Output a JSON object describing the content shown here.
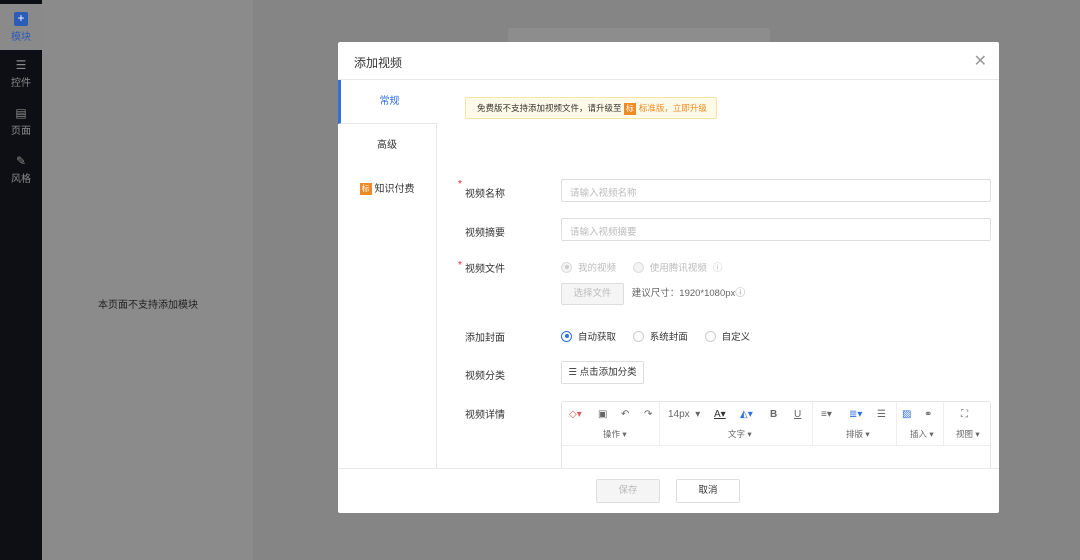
{
  "sidebar": {
    "items": [
      {
        "label": "模块",
        "icon": "plus-square-icon"
      },
      {
        "label": "控件",
        "icon": "sliders-icon"
      },
      {
        "label": "页面",
        "icon": "page-icon"
      },
      {
        "label": "风格",
        "icon": "magic-wand-icon"
      }
    ]
  },
  "panel": {
    "empty_text": "本页面不支持添加模块"
  },
  "modal": {
    "title": "添加视频",
    "tabs": [
      {
        "label": "常规"
      },
      {
        "label": "高级"
      },
      {
        "label": "知识付费",
        "badge": "标"
      }
    ],
    "notice": {
      "text": "免费版不支持添加视频文件，请升级至",
      "badge": "标",
      "edition": "标准版，",
      "link": "立即升级"
    },
    "fields": {
      "name": {
        "label": "视频名称",
        "placeholder": "请输入视频名称"
      },
      "summary": {
        "label": "视频摘要",
        "placeholder": "请输入视频摘要"
      },
      "file": {
        "label": "视频文件",
        "options": [
          "我的视频",
          "使用腾讯视频"
        ],
        "choose_button": "选择文件",
        "hint": "建议尺寸：1920*1080px"
      },
      "cover": {
        "label": "添加封面",
        "options": [
          "自动获取",
          "系统封面",
          "自定义"
        ]
      },
      "category": {
        "label": "视频分类",
        "button": "点击添加分类"
      },
      "detail": {
        "label": "视频详情",
        "font_size": "14px",
        "groups": [
          "操作",
          "文字",
          "排版",
          "插入",
          "视图"
        ]
      }
    },
    "footer": {
      "save": "保存",
      "cancel": "取消"
    }
  },
  "colors": {
    "accent": "#2f6fe0",
    "warning": "#f08a24"
  }
}
